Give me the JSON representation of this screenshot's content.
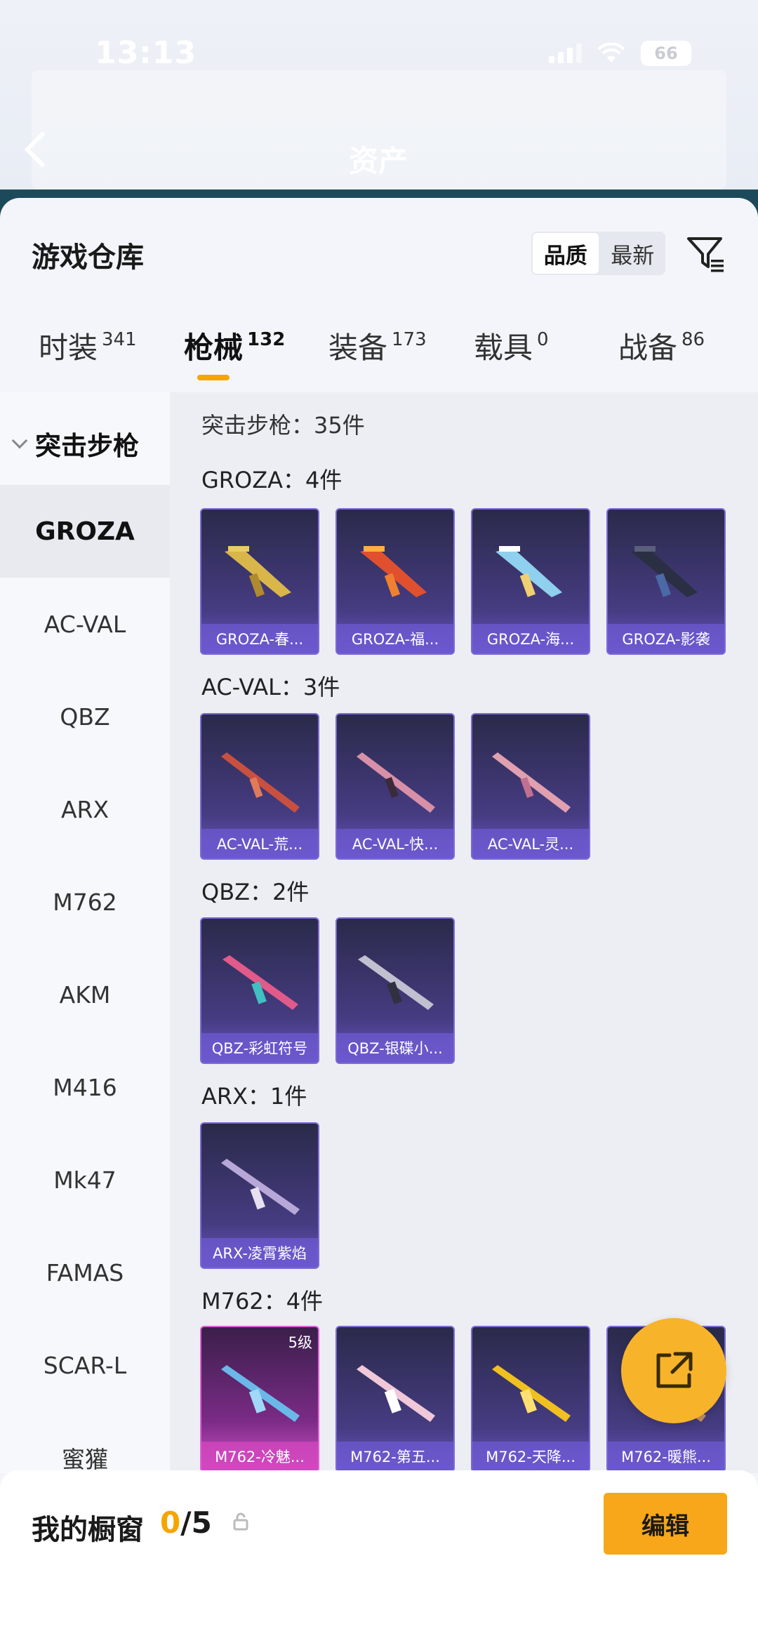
{
  "status_bar": {
    "time": "13:13",
    "battery": "66"
  },
  "header": {
    "title": "资产"
  },
  "warehouse": {
    "title": "游戏仓库",
    "sort_options": [
      "品质",
      "最新"
    ],
    "tabs": [
      {
        "label": "时装",
        "count": "341"
      },
      {
        "label": "枪械",
        "count": "132"
      },
      {
        "label": "装备",
        "count": "173"
      },
      {
        "label": "载具",
        "count": "0"
      },
      {
        "label": "战备",
        "count": "86"
      }
    ]
  },
  "categories": {
    "header": "突击步枪",
    "items": [
      "GROZA",
      "AC-VAL",
      "QBZ",
      "ARX",
      "M762",
      "AKM",
      "M416",
      "Mk47",
      "FAMAS",
      "SCAR-L",
      "蜜獾"
    ]
  },
  "content": {
    "total": "突击步枪：35件",
    "groups": [
      {
        "title": "GROZA：4件",
        "items": [
          "GROZA-春...",
          "GROZA-福...",
          "GROZA-海...",
          "GROZA-影袭"
        ]
      },
      {
        "title": "AC-VAL：3件",
        "items": [
          "AC-VAL-荒...",
          "AC-VAL-快...",
          "AC-VAL-灵..."
        ]
      },
      {
        "title": "QBZ：2件",
        "items": [
          "QBZ-彩虹符号",
          "QBZ-银碟小..."
        ]
      },
      {
        "title": "ARX：1件",
        "items": [
          "ARX-凌霄紫焰"
        ]
      },
      {
        "title": "M762：4件",
        "items": [
          "M762-冷魅...",
          "M762-第五...",
          "M762-天降...",
          "M762-暖熊..."
        ],
        "first_badge": "5级"
      }
    ]
  },
  "showcase": {
    "title": "我的橱窗",
    "current": "0",
    "total": "/5",
    "edit_label": "编辑"
  },
  "colors": {
    "accent": "#f5a500",
    "card_purple": "#463c82",
    "card_pink": "#d050c8"
  }
}
